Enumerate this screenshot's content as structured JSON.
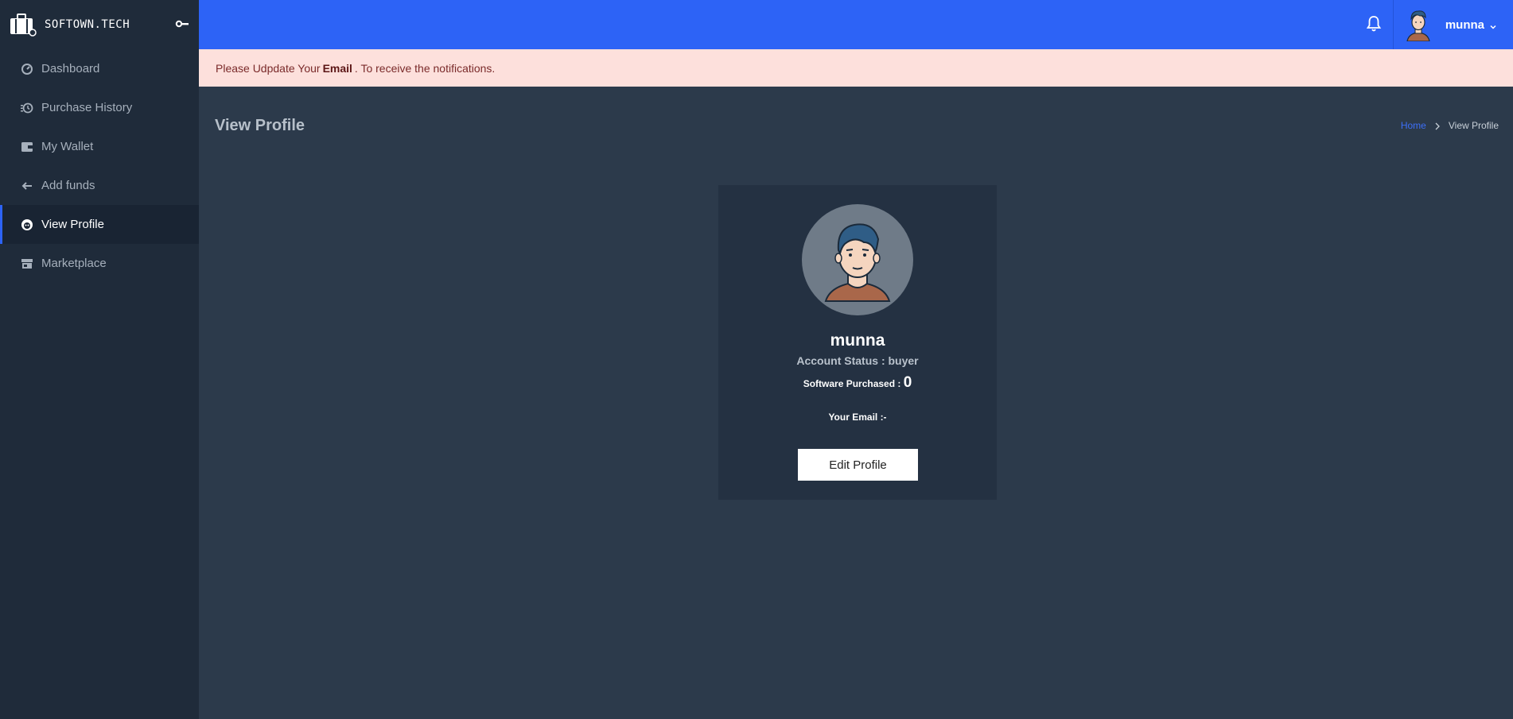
{
  "brand": {
    "name": "SOFTOWN.TECH"
  },
  "sidebar": {
    "items": [
      {
        "label": "Dashboard",
        "icon": "dashboard-icon"
      },
      {
        "label": "Purchase History",
        "icon": "history-icon"
      },
      {
        "label": "My Wallet",
        "icon": "wallet-icon"
      },
      {
        "label": "Add funds",
        "icon": "arrow-left-icon"
      },
      {
        "label": "View Profile",
        "icon": "profile-icon",
        "active": true
      },
      {
        "label": "Marketplace",
        "icon": "store-icon"
      }
    ]
  },
  "topbar": {
    "user_name": "munna"
  },
  "alert": {
    "prefix": "Please Udpdate Your",
    "bold": "Email",
    "suffix": ". To receive the notifications."
  },
  "page": {
    "title": "View Profile"
  },
  "breadcrumb": {
    "home": "Home",
    "current": "View Profile"
  },
  "profile": {
    "name": "munna",
    "status": "Account Status : buyer",
    "purchased_label": "Software Purchased :",
    "purchased_count": "0",
    "email_label": "Your Email :-",
    "edit_label": "Edit Profile"
  },
  "colors": {
    "accent": "#2d63f6",
    "sidebar_bg": "#1f2b3a",
    "content_bg": "#2c3a4b",
    "alert_bg": "#fde0dc"
  }
}
